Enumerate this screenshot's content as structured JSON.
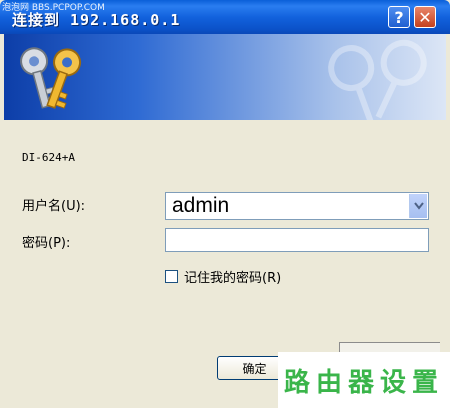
{
  "window": {
    "title": "连接到 192.168.0.1",
    "help_label": "?",
    "close_label": "✕"
  },
  "watermark_top": "泡泡网 BBS.PCPOP.COM",
  "device_name": "DI-624+A",
  "form": {
    "username_label": "用户名(U):",
    "username_value": "admin",
    "password_label": "密码(P):",
    "password_value": "",
    "remember_label": "记住我的密码(R)",
    "remember_checked": false
  },
  "buttons": {
    "ok_label": "确定"
  },
  "watermark_bottom": "路由器设置",
  "colors": {
    "titlebar": "#0b52c9",
    "dialog_bg": "#ece9d8",
    "watermark_green": "#3ab54a"
  },
  "icons": {
    "banner": "keys-icon",
    "combo": "chevron-down-icon"
  }
}
